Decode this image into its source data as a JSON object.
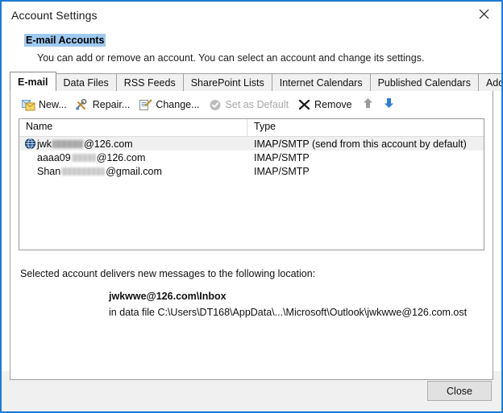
{
  "window": {
    "title": "Account Settings",
    "close_icon": "close-x-icon"
  },
  "banner": {
    "title": "E-mail Accounts",
    "subtitle": "You can add or remove an account. You can select an account and change its settings.",
    "highlight_color": "#9ec9f0"
  },
  "tabs": [
    {
      "label": "E-mail",
      "active": true
    },
    {
      "label": "Data Files",
      "active": false
    },
    {
      "label": "RSS Feeds",
      "active": false
    },
    {
      "label": "SharePoint Lists",
      "active": false
    },
    {
      "label": "Internet Calendars",
      "active": false
    },
    {
      "label": "Published Calendars",
      "active": false
    },
    {
      "label": "Address Books",
      "active": false
    }
  ],
  "toolbar": {
    "new_label": "New...",
    "repair_label": "Repair...",
    "change_label": "Change...",
    "set_as_default_label": "Set as Default",
    "remove_label": "Remove",
    "move_up_icon": "arrow-up-icon",
    "move_down_icon": "arrow-down-icon",
    "set_as_default_enabled": false,
    "move_up_enabled": false,
    "move_down_enabled": true
  },
  "list": {
    "columns": [
      "Name",
      "Type"
    ],
    "rows": [
      {
        "name_prefix": "jwk",
        "name_suffix": "@126.com",
        "redacted": true,
        "type": "IMAP/SMTP (send from this account by default)",
        "is_default": true,
        "selected": true
      },
      {
        "name_prefix": "aaaa09",
        "name_suffix": "@126.com",
        "redacted": true,
        "type": "IMAP/SMTP",
        "is_default": false,
        "selected": false
      },
      {
        "name_prefix": "Shan",
        "name_suffix": "@gmail.com",
        "redacted": true,
        "type": "IMAP/SMTP",
        "is_default": false,
        "selected": false
      }
    ]
  },
  "delivery": {
    "intro": "Selected account delivers new messages to the following location:",
    "location": "jwkwwe@126.com\\Inbox",
    "data_file": "in data file C:\\Users\\DT168\\AppData\\...\\Microsoft\\Outlook\\jwkwwe@126.com.ost"
  },
  "footer": {
    "close_label": "Close"
  },
  "colors": {
    "window_border": "#1e7bd4",
    "selection_blue": "#9ec9f0",
    "row_selected": "#f0f0f0",
    "accent_blue": "#3a7ebf"
  }
}
